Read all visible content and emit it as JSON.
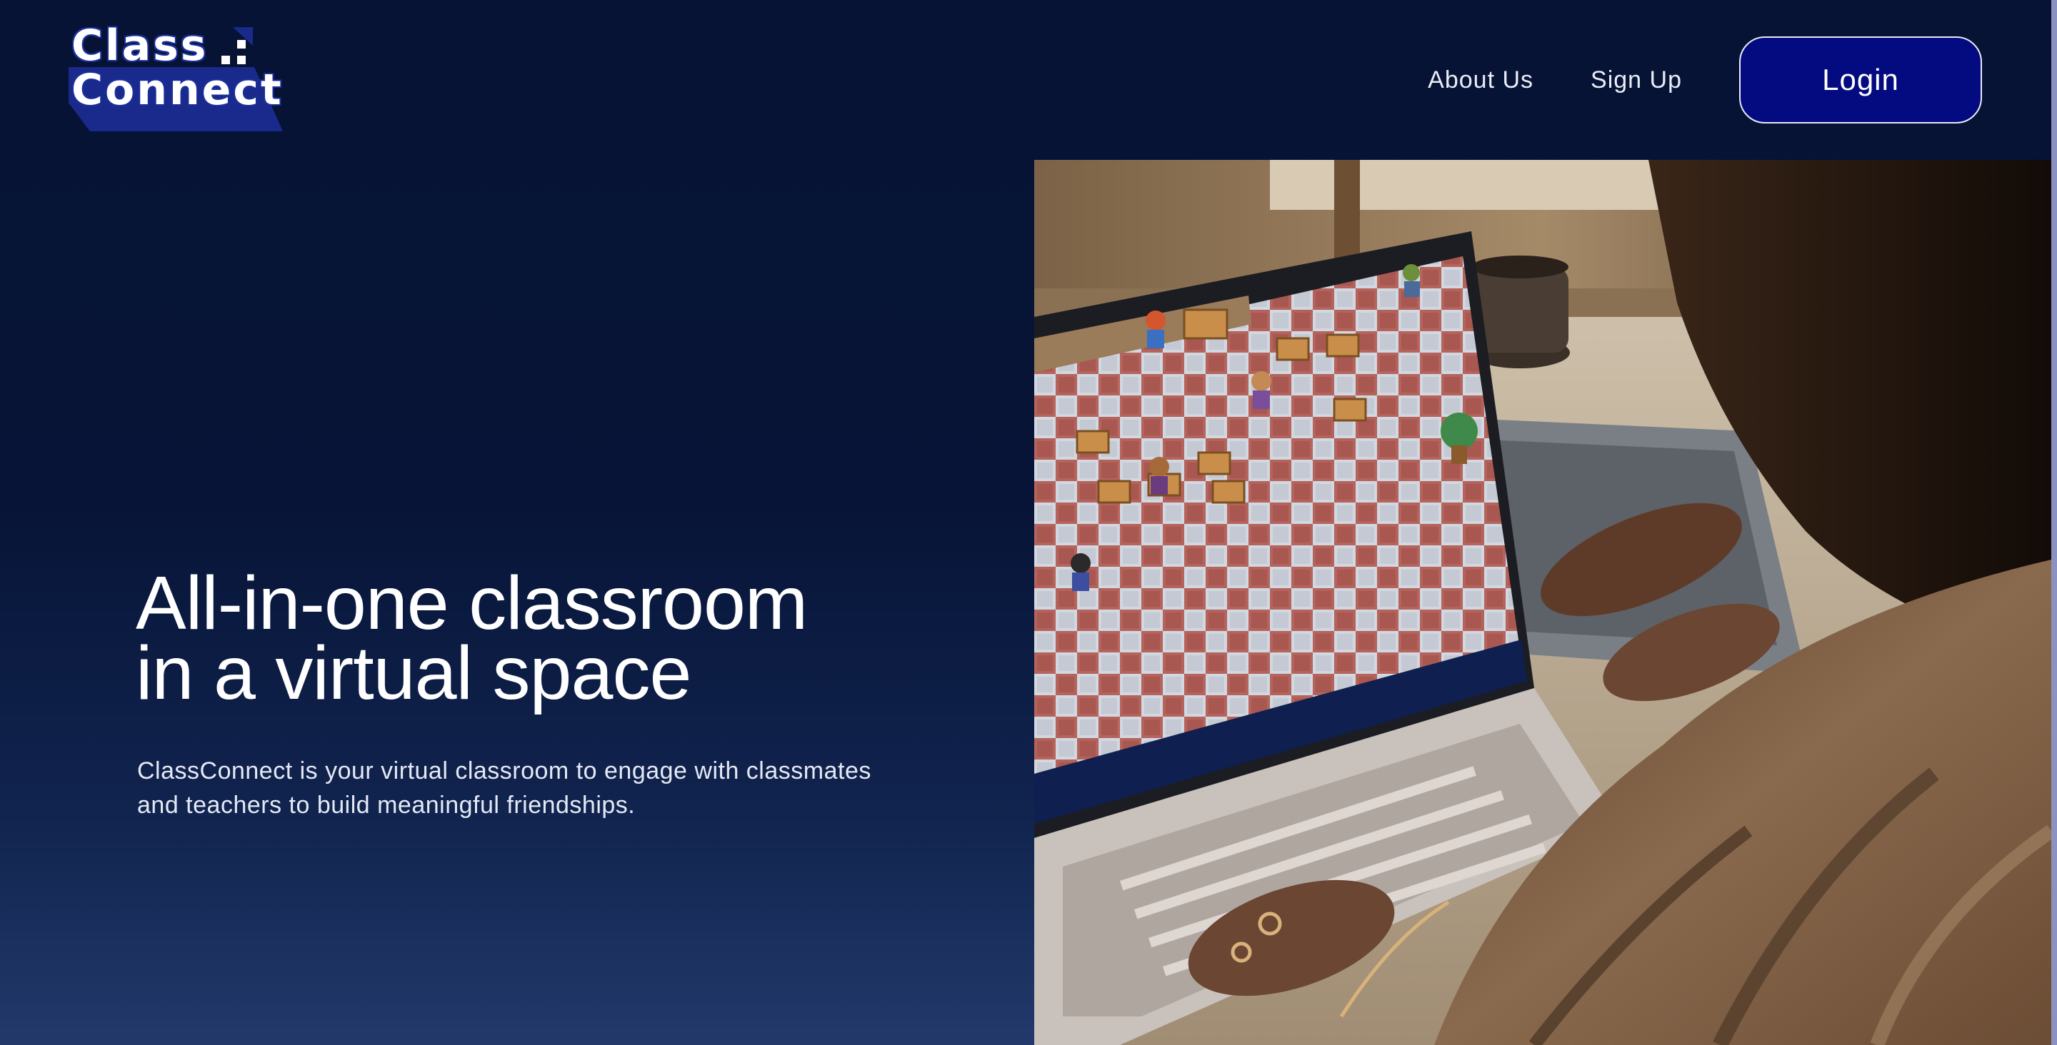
{
  "brand": {
    "logo_line1": "Class",
    "logo_line2": "Connect"
  },
  "nav": {
    "about": "About Us",
    "signup": "Sign Up",
    "login": "Login"
  },
  "hero": {
    "title_line1": "All-in-one classroom",
    "title_line2": "in a virtual space",
    "description_line1": "ClassConnect is your virtual classroom to engage with classmates",
    "description_line2": "and teachers to build meaningful friendships.",
    "image": "person typing on a laptop showing a pixel-art virtual classroom"
  },
  "colors": {
    "background_top": "#061334",
    "background_bottom": "#22396a",
    "login_button": "#040b80",
    "logo_accent": "#1b2f9a"
  }
}
